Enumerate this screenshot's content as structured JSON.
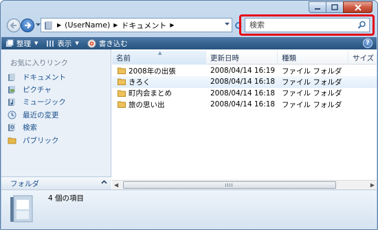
{
  "address": {
    "crumbs": [
      "(UserName)",
      "ドキュメント"
    ]
  },
  "search": {
    "placeholder": "検索"
  },
  "toolbar": {
    "organize_label": "整理",
    "view_label": "表示",
    "burn_label": "書き込む",
    "help_label": "?"
  },
  "nav": {
    "favorites_header": "お気に入りリンク",
    "items": [
      {
        "label": "ドキュメント",
        "icon": "documents-icon"
      },
      {
        "label": "ピクチャ",
        "icon": "pictures-icon"
      },
      {
        "label": "ミュージック",
        "icon": "music-icon"
      },
      {
        "label": "最近の変更",
        "icon": "recent-icon"
      },
      {
        "label": "検索",
        "icon": "searches-icon"
      },
      {
        "label": "パブリック",
        "icon": "public-folder-icon"
      }
    ],
    "folders_label": "フォルダ"
  },
  "columns": {
    "name": "名前",
    "date": "更新日時",
    "type": "種類",
    "size": "サイズ"
  },
  "files": [
    {
      "name": "2008年の出張",
      "date": "2008/04/14 16:19",
      "type": "ファイル フォルダ"
    },
    {
      "name": "きろく",
      "date": "2008/04/14 16:18",
      "type": "ファイル フォルダ"
    },
    {
      "name": "町内会まとめ",
      "date": "2008/04/14 16:18",
      "type": "ファイル フォルダ"
    },
    {
      "name": "旅の思い出",
      "date": "2008/04/14 16:18",
      "type": "ファイル フォルダ"
    }
  ],
  "status": {
    "item_count": "4 個の項目"
  },
  "colors": {
    "highlight": "#e60012",
    "toolbar": "#34628f",
    "link": "#1a4f8c"
  }
}
